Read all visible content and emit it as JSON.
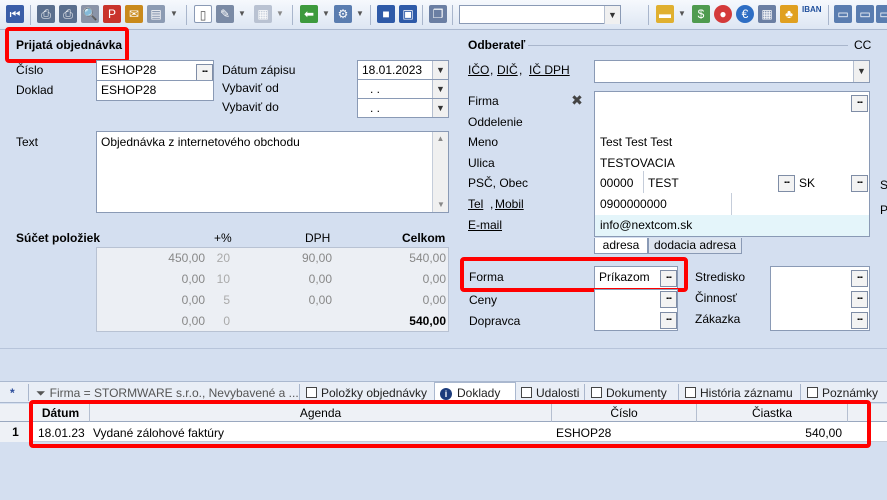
{
  "order_section": {
    "title": "Prijatá objednávka",
    "cislo_label": "Číslo",
    "cislo_value": "ESHOP28",
    "doklad_label": "Doklad",
    "doklad_value": "ESHOP28",
    "datum_zapisu_label": "Dátum zápisu",
    "datum_zapisu_value": "18.01.2023",
    "vybavit_od_label": "Vybaviť od",
    "vybavit_od_value": ". .",
    "vybavit_do_label": "Vybaviť do",
    "vybavit_do_value": ". .",
    "text_label": "Text",
    "text_value": "Objednávka z internetového obchodu"
  },
  "summary": {
    "title": "Súčet položiek",
    "headers": [
      "+%",
      "DPH",
      "Celkom"
    ],
    "rows": [
      [
        "450,00",
        "20",
        "90,00",
        "540,00"
      ],
      [
        "0,00",
        "10",
        "0,00",
        "0,00"
      ],
      [
        "0,00",
        "5",
        "0,00",
        "0,00"
      ],
      [
        "0,00",
        "0",
        "",
        "540,00"
      ]
    ]
  },
  "customer": {
    "title": "Odberateľ",
    "cc": "CC",
    "ico_label": "IČO",
    "dic_label": "DIČ",
    "icdph_label": "IČ DPH",
    "firma_label": "Firma",
    "oddelenie_label": "Oddelenie",
    "meno_label": "Meno",
    "meno_value": "Test Test Test",
    "ulica_label": "Ulica",
    "ulica_value": "TESTOVACIA",
    "psc_label": "PSČ, Obec",
    "psc_value": "00000",
    "obec_value": "TEST",
    "country_value": "SK",
    "tel_label": "Tel",
    "mobil_label": "Mobil",
    "tel_value": "0900000000",
    "email_label": "E-mail",
    "email_value": "info@nextcom.sk",
    "tab_adresa": "adresa",
    "tab_dodacia": "dodacia adresa"
  },
  "payment": {
    "forma_label": "Forma",
    "forma_value": "Príkazom",
    "ceny_label": "Ceny",
    "dopravca_label": "Dopravca",
    "stredisko_label": "Stredisko",
    "cinnost_label": "Činnosť",
    "zakazka_label": "Zákazka"
  },
  "bottom_tabs": {
    "star": "*",
    "filter": "Firma = STORMWARE s.r.o., Nevybavené a ...",
    "polozky": "Položky objednávky",
    "doklady": "Doklady",
    "udalosti": "Udalosti",
    "dokumenty": "Dokumenty",
    "historia": "História záznamu",
    "poznamky": "Poznámky"
  },
  "table": {
    "headers": {
      "datum": "Dátum",
      "agenda": "Agenda",
      "cislo": "Číslo",
      "ciastka": "Čiastka"
    },
    "rows": [
      {
        "num": "1",
        "datum": "18.01.23",
        "agenda": "Vydané zálohové faktúry",
        "cislo": "ESHOP28",
        "ciastka": "540,00"
      }
    ]
  },
  "toolbar": {
    "iban": "IBAN"
  },
  "colors": {
    "highlight": "#ff0000",
    "background": "#d4dff0"
  }
}
